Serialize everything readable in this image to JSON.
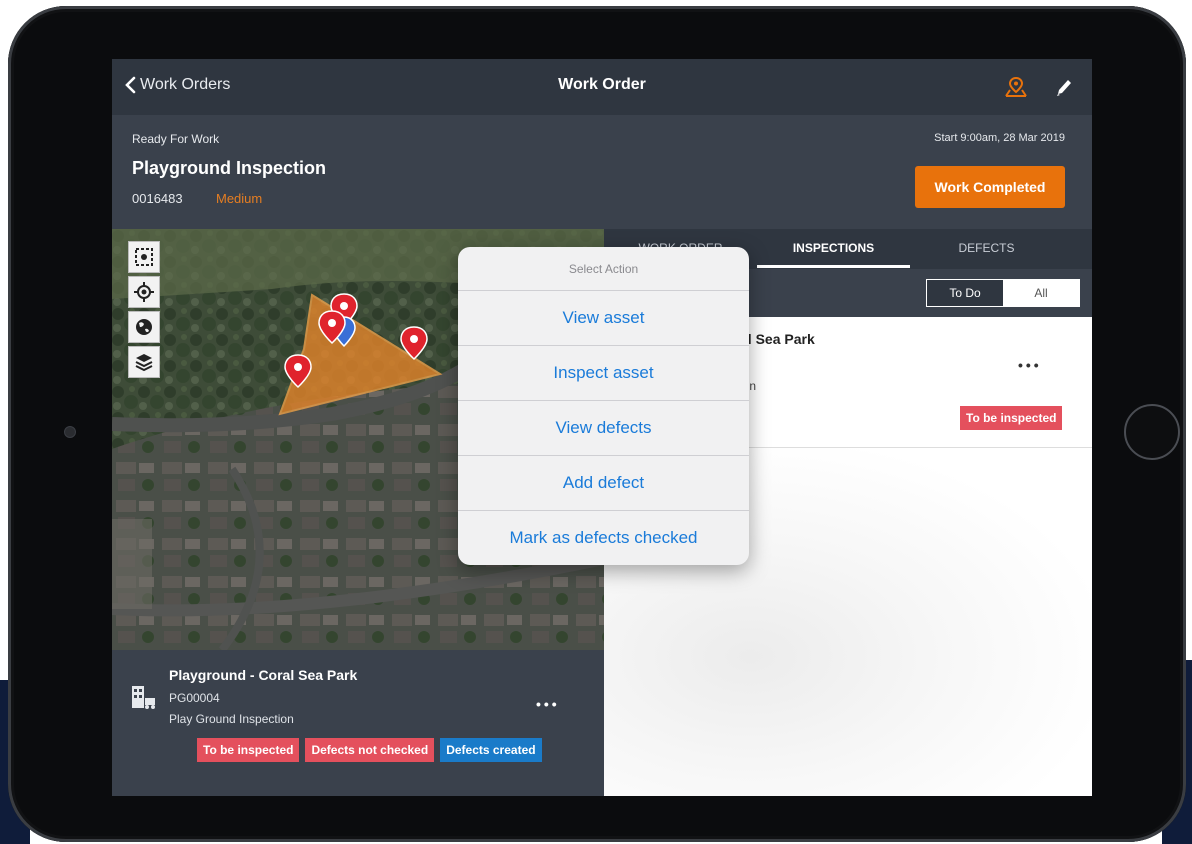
{
  "navbar": {
    "back_label": "Work Orders",
    "title": "Work Order",
    "map_icon": "map-pin-icon",
    "edit_icon": "pencil-icon"
  },
  "work_order": {
    "status": "Ready For Work",
    "title": "Playground Inspection",
    "number": "0016483",
    "priority": "Medium",
    "start": "Start 9:00am, 28 Mar 2019",
    "complete_button": "Work Completed"
  },
  "map_tools": [
    "select-area-icon",
    "locate-icon",
    "globe-icon",
    "layers-icon"
  ],
  "asset": {
    "name": "Playground - Coral Sea Park",
    "code": "PG00004",
    "type": "Play Ground Inspection",
    "more": "•••",
    "badges": [
      "To be inspected",
      "Defects not checked",
      "Defects created"
    ]
  },
  "tabs": [
    "WORK ORDER",
    "INSPECTIONS",
    "DEFECTS"
  ],
  "filter": {
    "todo": "To Do",
    "all": "All"
  },
  "list": {
    "title_partial": "al Sea Park",
    "type_partial": "ion",
    "more": "•••",
    "badge": "To be inspected"
  },
  "popover": {
    "title": "Select Action",
    "items": [
      "View asset",
      "Inspect asset",
      "View defects",
      "Add defect",
      "Mark as defects checked"
    ]
  },
  "colors": {
    "accent_orange": "#e8720c",
    "badge_red": "#e4505d",
    "badge_blue": "#1a7bc9",
    "action_blue": "#1a7bd9"
  }
}
